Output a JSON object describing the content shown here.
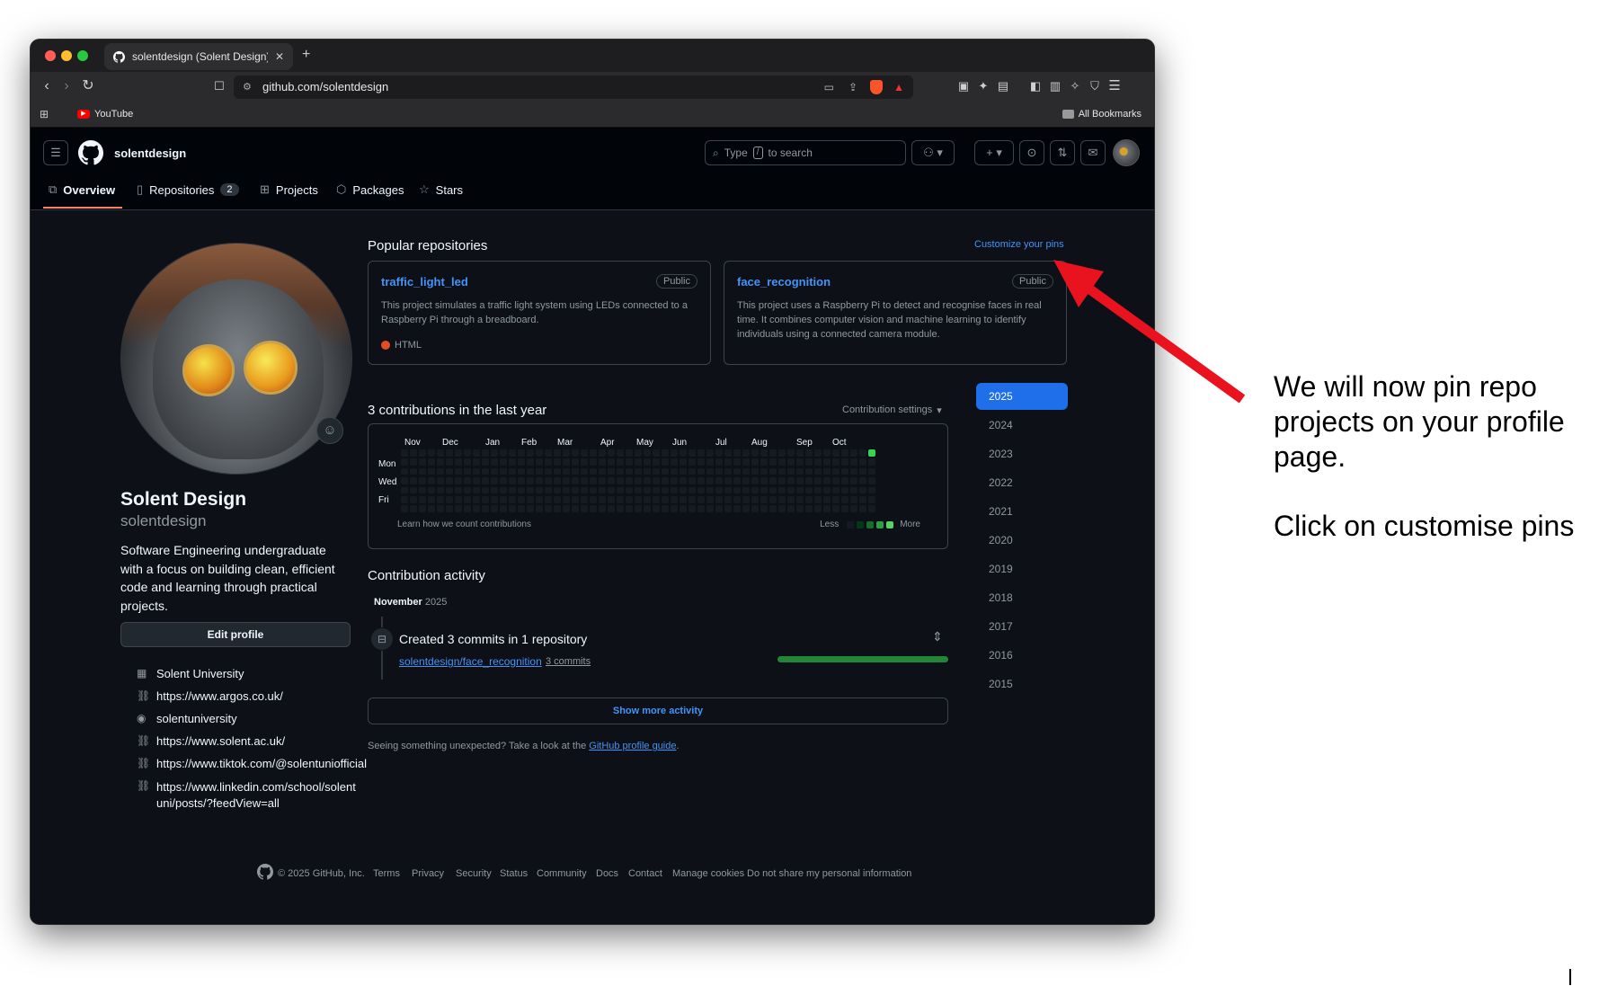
{
  "browser": {
    "tab_title": "solentdesign (Solent Design)",
    "url": "github.com/solentdesign",
    "bookmark_youtube": "YouTube",
    "all_bookmarks": "All Bookmarks"
  },
  "header": {
    "username": "solentdesign",
    "search_type": "Type",
    "search_kbd": "/",
    "search_rest": "to search"
  },
  "nav": {
    "overview": "Overview",
    "repositories": "Repositories",
    "repo_count": "2",
    "projects": "Projects",
    "packages": "Packages",
    "stars": "Stars"
  },
  "profile": {
    "name": "Solent Design",
    "login": "solentdesign",
    "bio": "Software Engineering undergraduate with a focus on building clean, efficient code and learning through practical projects.",
    "edit_button": "Edit profile",
    "org": "Solent University",
    "links": [
      "https://www.argos.co.uk/",
      "solentuniversity",
      "https://www.solent.ac.uk/",
      "https://www.tiktok.com/@solentuniofficial",
      "https://www.linkedin.com/school/solentuni/posts/?feedView=all"
    ]
  },
  "popular": {
    "heading": "Popular repositories",
    "customize": "Customize your pins",
    "repos": [
      {
        "name": "traffic_light_led",
        "visibility": "Public",
        "desc": "This project simulates a traffic light system using LEDs connected to a Raspberry Pi through a breadboard.",
        "lang": "HTML"
      },
      {
        "name": "face_recognition",
        "visibility": "Public",
        "desc": "This project uses a Raspberry Pi to detect and recognise faces in real time. It combines computer vision and machine learning to identify individuals using a connected camera module.",
        "lang": ""
      }
    ]
  },
  "contrib": {
    "heading": "3 contributions in the last year",
    "settings": "Contribution settings",
    "months": [
      "Nov",
      "Dec",
      "Jan",
      "Feb",
      "Mar",
      "Apr",
      "May",
      "Jun",
      "Jul",
      "Aug",
      "Sep",
      "Oct"
    ],
    "days": [
      "Mon",
      "Wed",
      "Fri"
    ],
    "learn": "Learn how we count contributions",
    "less": "Less",
    "more": "More",
    "years": [
      "2025",
      "2024",
      "2023",
      "2022",
      "2021",
      "2020",
      "2019",
      "2018",
      "2017",
      "2016",
      "2015"
    ],
    "selected_year": "2025"
  },
  "activity": {
    "heading": "Contribution activity",
    "month": "November",
    "year": "2025",
    "event": "Created 3 commits in 1 repository",
    "repo": "solentdesign/face_recognition",
    "commits": "3 commits",
    "show_more": "Show more activity",
    "unexpected": "Seeing something unexpected? Take a look at the",
    "guide": "GitHub profile guide",
    "period": "."
  },
  "footer": {
    "copyright": "© 2025 GitHub, Inc.",
    "links": [
      "Terms",
      "Privacy",
      "Security",
      "Status",
      "Community",
      "Docs",
      "Contact",
      "Manage cookies",
      "Do not share my personal information"
    ]
  },
  "annotation": {
    "line1": "We will now pin repo",
    "line2": "projects on your profile",
    "line3": "page.",
    "line4": "Click on customise pins"
  },
  "colors": {
    "accent": "#4493f8",
    "year_selected": "#1f6feb",
    "arrow": "#e8131f",
    "contrib_green": "#39d353"
  }
}
